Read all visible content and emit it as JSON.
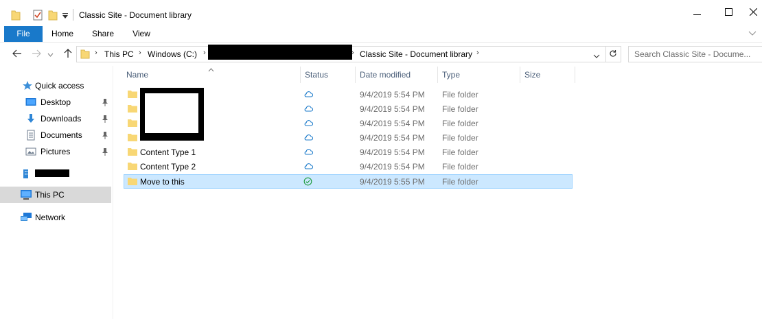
{
  "window": {
    "title": "Classic Site - Document library",
    "minimize_icon": "minimize-icon",
    "maximize_icon": "maximize-icon",
    "close_icon": "close-icon"
  },
  "ribbon": {
    "tabs": [
      {
        "label": "File",
        "active": true
      },
      {
        "label": "Home"
      },
      {
        "label": "Share"
      },
      {
        "label": "View"
      }
    ]
  },
  "address": {
    "crumbs": [
      "This PC",
      "Windows (C:)",
      "Classic Site - Document library"
    ],
    "search_placeholder": "Search Classic Site - Docume..."
  },
  "nav": {
    "items": [
      {
        "label": "Quick access",
        "icon": "star-icon"
      },
      {
        "label": "Desktop",
        "icon": "desktop-icon",
        "pinned": true
      },
      {
        "label": "Downloads",
        "icon": "download-icon",
        "pinned": true
      },
      {
        "label": "Documents",
        "icon": "documents-icon",
        "pinned": true
      },
      {
        "label": "Pictures",
        "icon": "pictures-icon",
        "pinned": true
      },
      {
        "label": "",
        "icon": "building-icon",
        "redacted": true
      },
      {
        "label": "This PC",
        "icon": "computer-icon",
        "selected": true
      },
      {
        "label": "Network",
        "icon": "network-icon"
      }
    ]
  },
  "columns": [
    "Name",
    "Status",
    "Date modified",
    "Type",
    "Size"
  ],
  "files": [
    {
      "name": "",
      "status": "cloud",
      "date": "9/4/2019 5:54 PM",
      "type": "File folder",
      "redacted": true
    },
    {
      "name": "",
      "status": "cloud",
      "date": "9/4/2019 5:54 PM",
      "type": "File folder",
      "redacted": true
    },
    {
      "name": "",
      "status": "cloud",
      "date": "9/4/2019 5:54 PM",
      "type": "File folder",
      "redacted": true
    },
    {
      "name": "",
      "status": "cloud",
      "date": "9/4/2019 5:54 PM",
      "type": "File folder",
      "redacted": true
    },
    {
      "name": "Content Type 1",
      "status": "cloud",
      "date": "9/4/2019 5:54 PM",
      "type": "File folder"
    },
    {
      "name": "Content Type 2",
      "status": "cloud",
      "date": "9/4/2019 5:54 PM",
      "type": "File folder"
    },
    {
      "name": "Move to this",
      "status": "synced",
      "date": "9/4/2019 5:55 PM",
      "type": "File folder",
      "selected": true
    }
  ],
  "colors": {
    "file_tab": "#1979ca",
    "selection": "#cce8ff",
    "status_cloud": "#1979ca",
    "status_synced": "#1a9a3a",
    "folder": "#f8d775"
  }
}
